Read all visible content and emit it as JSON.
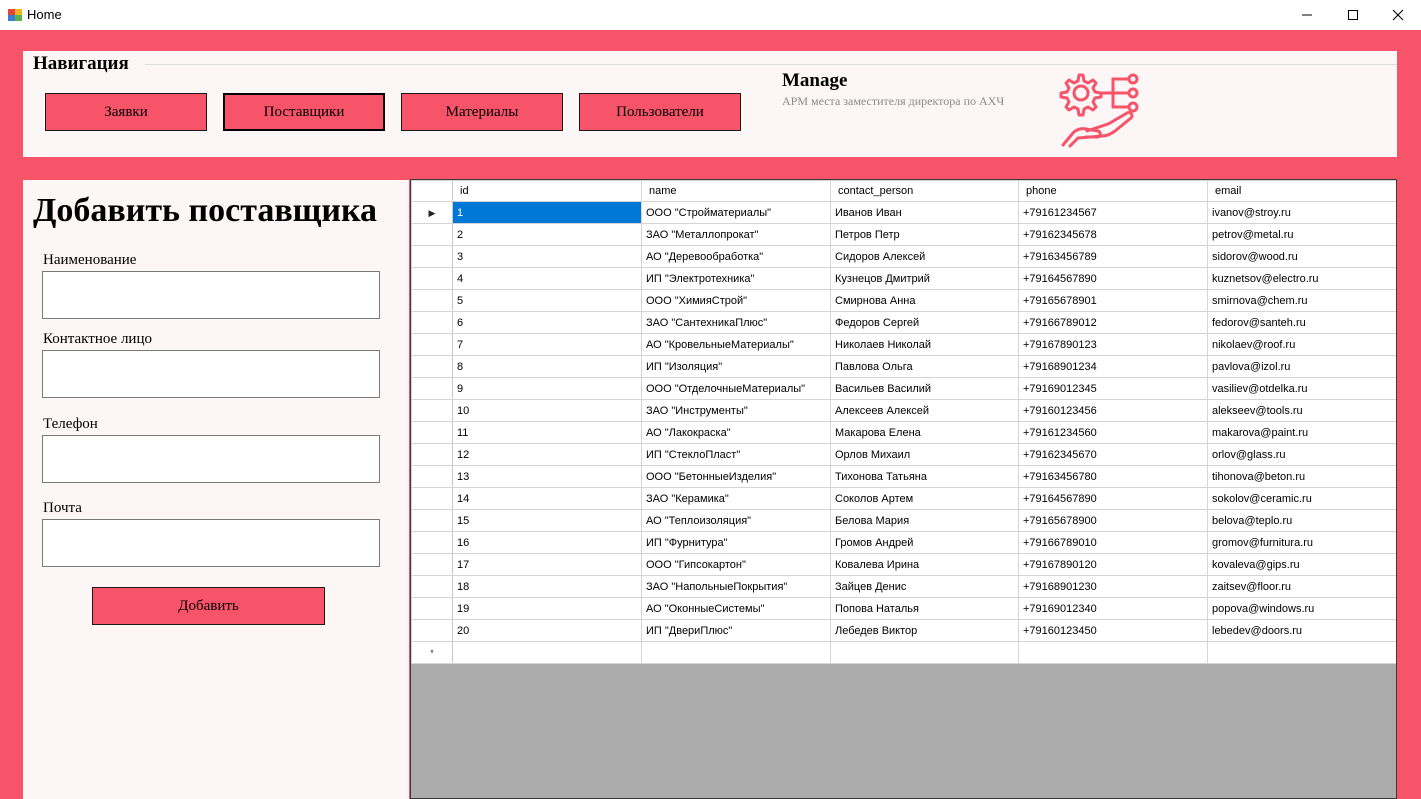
{
  "window": {
    "title": "Home",
    "controls": {
      "minimize": "minimize-icon",
      "maximize": "maximize-icon",
      "close": "close-icon"
    }
  },
  "colors": {
    "accent": "#f85469",
    "panel": "#fdf6f6",
    "selection": "#0078d7",
    "grid_empty": "#ababab"
  },
  "nav": {
    "title": "Навигация",
    "buttons": [
      "Заявки",
      "Поставщики",
      "Материалы",
      "Пользователи"
    ],
    "active_button": "Поставщики"
  },
  "manage": {
    "title": "Manage",
    "subtitle": "АРМ места заместителя директора по АХЧ",
    "logo_icon": "gears-hand-icon"
  },
  "form": {
    "title": "Добавить поставщика",
    "fields": [
      {
        "label": "Наименование",
        "value": ""
      },
      {
        "label": "Контактное лицо",
        "value": ""
      },
      {
        "label": "Телефон",
        "value": ""
      },
      {
        "label": "Почта",
        "value": ""
      }
    ],
    "submit_label": "Добавить"
  },
  "grid": {
    "columns": [
      "id",
      "name",
      "contact_person",
      "phone",
      "email"
    ],
    "current_row_glyph": "▶",
    "new_row_glyph": "*",
    "rows": [
      [
        "1",
        "ООО \"Стройматериалы\"",
        "Иванов Иван",
        "+79161234567",
        "ivanov@stroy.ru"
      ],
      [
        "2",
        "ЗАО \"Металлопрокат\"",
        "Петров Петр",
        "+79162345678",
        "petrov@metal.ru"
      ],
      [
        "3",
        "АО \"Деревообработка\"",
        "Сидоров Алексей",
        "+79163456789",
        "sidorov@wood.ru"
      ],
      [
        "4",
        "ИП \"Электротехника\"",
        "Кузнецов Дмитрий",
        "+79164567890",
        "kuznetsov@electro.ru"
      ],
      [
        "5",
        "ООО \"ХимияСтрой\"",
        "Смирнова Анна",
        "+79165678901",
        "smirnova@chem.ru"
      ],
      [
        "6",
        "ЗАО \"СантехникаПлюс\"",
        "Федоров Сергей",
        "+79166789012",
        "fedorov@santeh.ru"
      ],
      [
        "7",
        "АО \"КровельныеМатериалы\"",
        "Николаев Николай",
        "+79167890123",
        "nikolaev@roof.ru"
      ],
      [
        "8",
        "ИП \"Изоляция\"",
        "Павлова Ольга",
        "+79168901234",
        "pavlova@izol.ru"
      ],
      [
        "9",
        "ООО \"ОтделочныеМатериалы\"",
        "Васильев Василий",
        "+79169012345",
        "vasiliev@otdelka.ru"
      ],
      [
        "10",
        "ЗАО \"Инструменты\"",
        "Алексеев Алексей",
        "+79160123456",
        "alekseev@tools.ru"
      ],
      [
        "11",
        "АО \"Лакокраска\"",
        "Макарова Елена",
        "+79161234560",
        "makarova@paint.ru"
      ],
      [
        "12",
        "ИП \"СтеклоПласт\"",
        "Орлов Михаил",
        "+79162345670",
        "orlov@glass.ru"
      ],
      [
        "13",
        "ООО \"БетонныеИзделия\"",
        "Тихонова Татьяна",
        "+79163456780",
        "tihonova@beton.ru"
      ],
      [
        "14",
        "ЗАО \"Керамика\"",
        "Соколов Артем",
        "+79164567890",
        "sokolov@ceramic.ru"
      ],
      [
        "15",
        "АО \"Теплоизоляция\"",
        "Белова Мария",
        "+79165678900",
        "belova@teplo.ru"
      ],
      [
        "16",
        "ИП \"Фурнитура\"",
        "Громов Андрей",
        "+79166789010",
        "gromov@furnitura.ru"
      ],
      [
        "17",
        "ООО \"Гипсокартон\"",
        "Ковалева Ирина",
        "+79167890120",
        "kovaleva@gips.ru"
      ],
      [
        "18",
        "ЗАО \"НапольныеПокрытия\"",
        "Зайцев Денис",
        "+79168901230",
        "zaitsev@floor.ru"
      ],
      [
        "19",
        "АО \"ОконныеСистемы\"",
        "Попова Наталья",
        "+79169012340",
        "popova@windows.ru"
      ],
      [
        "20",
        "ИП \"ДвериПлюс\"",
        "Лебедев Виктор",
        "+79160123450",
        "lebedev@doors.ru"
      ]
    ]
  }
}
